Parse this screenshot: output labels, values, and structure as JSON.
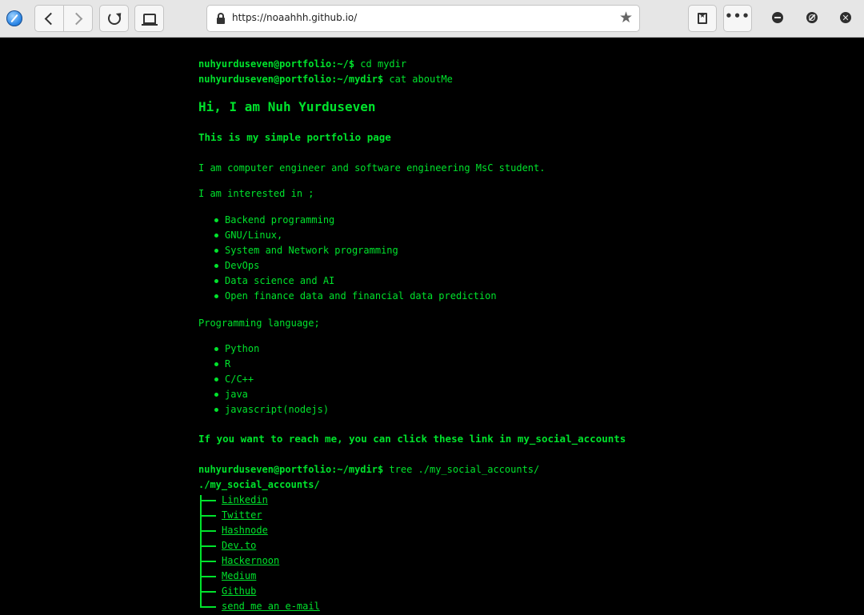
{
  "browser": {
    "url": "https://noaahhh.github.io/"
  },
  "terminal": {
    "cmd1": {
      "prompt": "nuhyurduseven@portfolio:~/$",
      "command": " cd mydir"
    },
    "cmd2": {
      "prompt": "nuhyurduseven@portfolio:~/mydir$",
      "command": " cat aboutMe"
    },
    "heading": "Hi, I am Nuh Yurduseven",
    "subheading": "This is my simple portfolio page",
    "intro": "I am computer engineer and software engineering MsC student.",
    "interests_title": "I am interested in ;",
    "interests": [
      "Backend programming",
      "GNU/Linux,",
      "System and Network programming",
      "DevOps",
      "Data science and AI",
      "Open finance data and financial data prediction"
    ],
    "languages_title": "Programming language;",
    "languages": [
      "Python",
      "R",
      "C/C++",
      "java",
      "javascript(nodejs)"
    ],
    "reach_text": "If you want to reach me, you can click these link in my_social_accounts",
    "cmd3": {
      "prompt": "nuhyurduseven@portfolio:~/mydir$",
      "command": " tree ./my_social_accounts/"
    },
    "tree_root": "./my_social_accounts/",
    "social_links": [
      "Linkedin",
      "Twitter",
      "Hashnode",
      "Dev.to",
      "Hackernoon",
      "Medium",
      "Github",
      "send me an e-mail"
    ]
  },
  "colors": {
    "terminal_green": "#00e32c",
    "background": "#000000",
    "chrome": "#e6e6e6"
  },
  "icons": [
    "app-icon",
    "back-icon",
    "forward-icon",
    "reload-icon",
    "tab-icon",
    "lock-icon",
    "star-icon",
    "bookmarks-icon",
    "menu-dots-icon",
    "minimize-icon",
    "maximize-icon",
    "close-icon"
  ]
}
